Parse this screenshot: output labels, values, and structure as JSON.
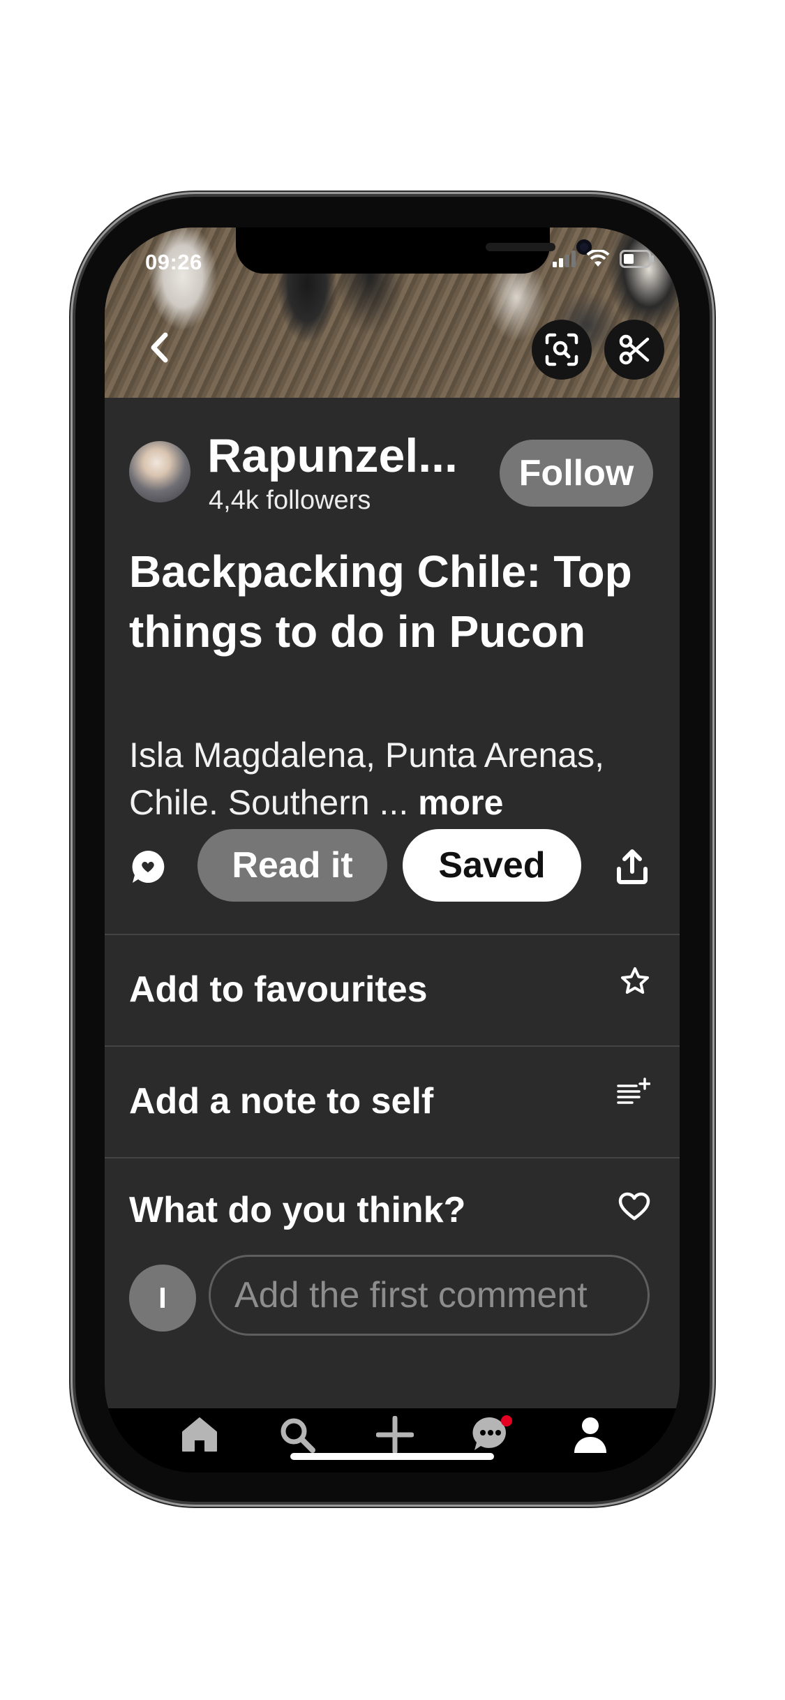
{
  "status_bar": {
    "time": "09:26"
  },
  "hero": {
    "back_icon": "chevron-left-icon",
    "visual_search_icon": "visual-search-icon",
    "cut_icon": "scissors-icon"
  },
  "author": {
    "name": "Rapunzel...",
    "followers": "4,4k followers",
    "follow_label": "Follow"
  },
  "pin": {
    "title": "Backpacking Chile: Top things to do in Pucon",
    "description": "Isla Magdalena, Punta Arenas, Chile. Southern ...",
    "more_label": "more"
  },
  "actions": {
    "comment_icon": "comment-icon",
    "read_label": "Read it",
    "saved_label": "Saved",
    "share_icon": "share-icon"
  },
  "list": {
    "favourites_label": "Add to favourites",
    "favourites_icon": "star-icon",
    "note_label": "Add a note to self",
    "note_icon": "add-note-icon",
    "think_label": "What do you think?",
    "think_icon": "heart-icon"
  },
  "comment": {
    "avatar_initial": "I",
    "placeholder": "Add the first comment"
  },
  "nav": {
    "items": [
      "home-icon",
      "search-icon",
      "create-icon",
      "messages-icon",
      "profile-icon"
    ],
    "notification_color": "#e60023"
  }
}
